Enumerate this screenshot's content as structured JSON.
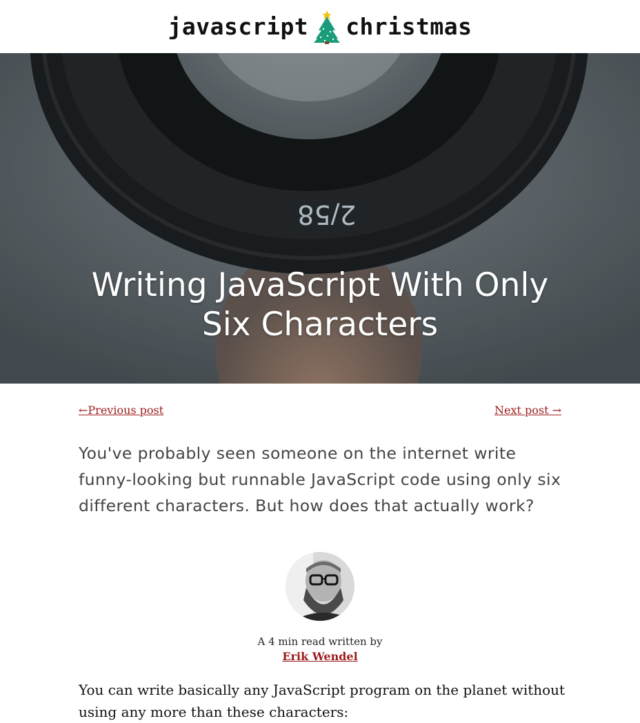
{
  "header": {
    "site_title_left": "javascript",
    "site_title_right": "christmas",
    "logo_icon": "christmas-tree-icon"
  },
  "hero": {
    "title_line1": "Writing JavaScript With Only",
    "title_line2": "Six Characters",
    "lens_marking": "2/58"
  },
  "post_nav": {
    "previous_label": "←Previous post",
    "next_label": "Next post →"
  },
  "intro": {
    "text": "You've probably seen someone on the internet write funny-looking but runnable JavaScript code using only six different characters. But how does that actually work?"
  },
  "author": {
    "byline": "A 4 min read written by",
    "name": "Erik Wendel"
  },
  "body": {
    "paragraph": "You can write basically any JavaScript program on the planet without using any more than these characters:"
  },
  "colors": {
    "link": "#9b1c1c",
    "tree": "#1a9b7a",
    "star": "#f2c40f"
  }
}
